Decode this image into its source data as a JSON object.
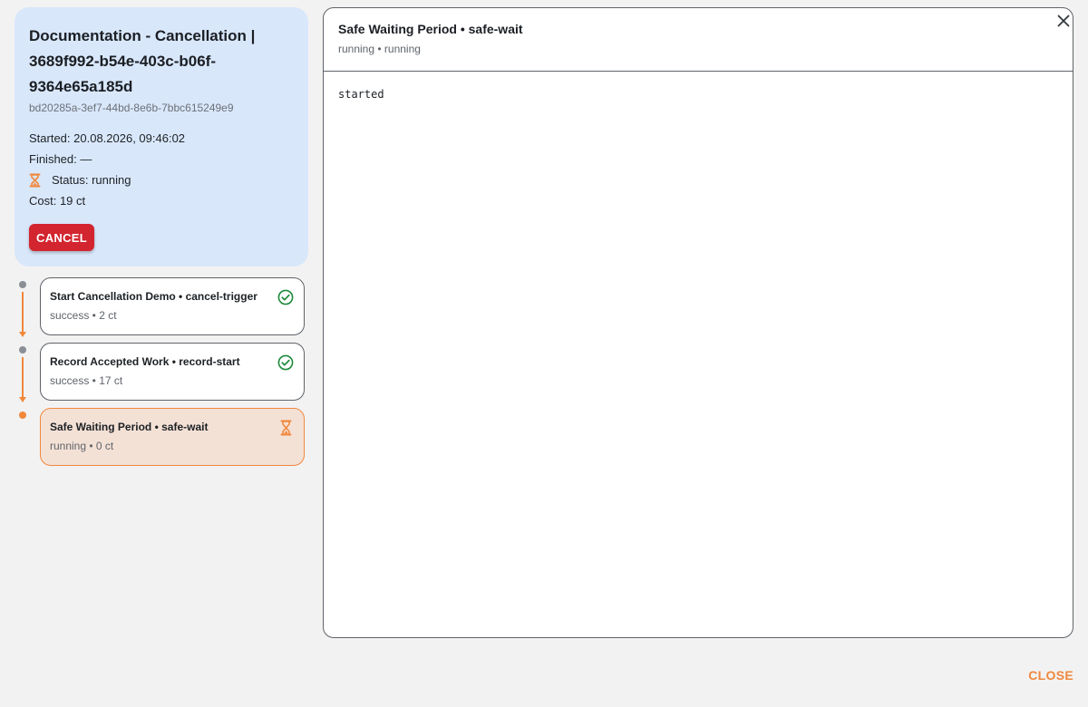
{
  "run": {
    "title": "Documentation - Cancellation | 3689f992-b54e-403c-b06f-9364e65a185d",
    "run_id": "bd20285a-3ef7-44bd-8e6b-7bbc615249e9",
    "started": "Started: 20.08.2026, 09:46:02",
    "finished": "Finished: —",
    "status": "Status: running",
    "cost": "Cost: 19 ct",
    "cancel_label": "CANCEL"
  },
  "steps": [
    {
      "name": "Start Cancellation Demo • cancel-trigger",
      "sub": "success • 2 ct",
      "status": "success",
      "icon": "check-circle-icon"
    },
    {
      "name": "Record Accepted Work • record-start",
      "sub": "success • 17 ct",
      "status": "success",
      "icon": "check-circle-icon"
    },
    {
      "name": "Safe Waiting Period • safe-wait",
      "sub": "running • 0 ct",
      "status": "running",
      "icon": "hourglass-icon"
    }
  ],
  "detail": {
    "title": "Safe Waiting Period • safe-wait",
    "subtitle": "running • running",
    "log": "started"
  },
  "footer": {
    "close_label": "CLOSE"
  },
  "colors": {
    "accent": "#f0883c",
    "danger": "#d3252f",
    "success": "#1e8a3c",
    "summary_bg": "#d9e7fb",
    "active_step_bg": "#f4e1d6"
  }
}
